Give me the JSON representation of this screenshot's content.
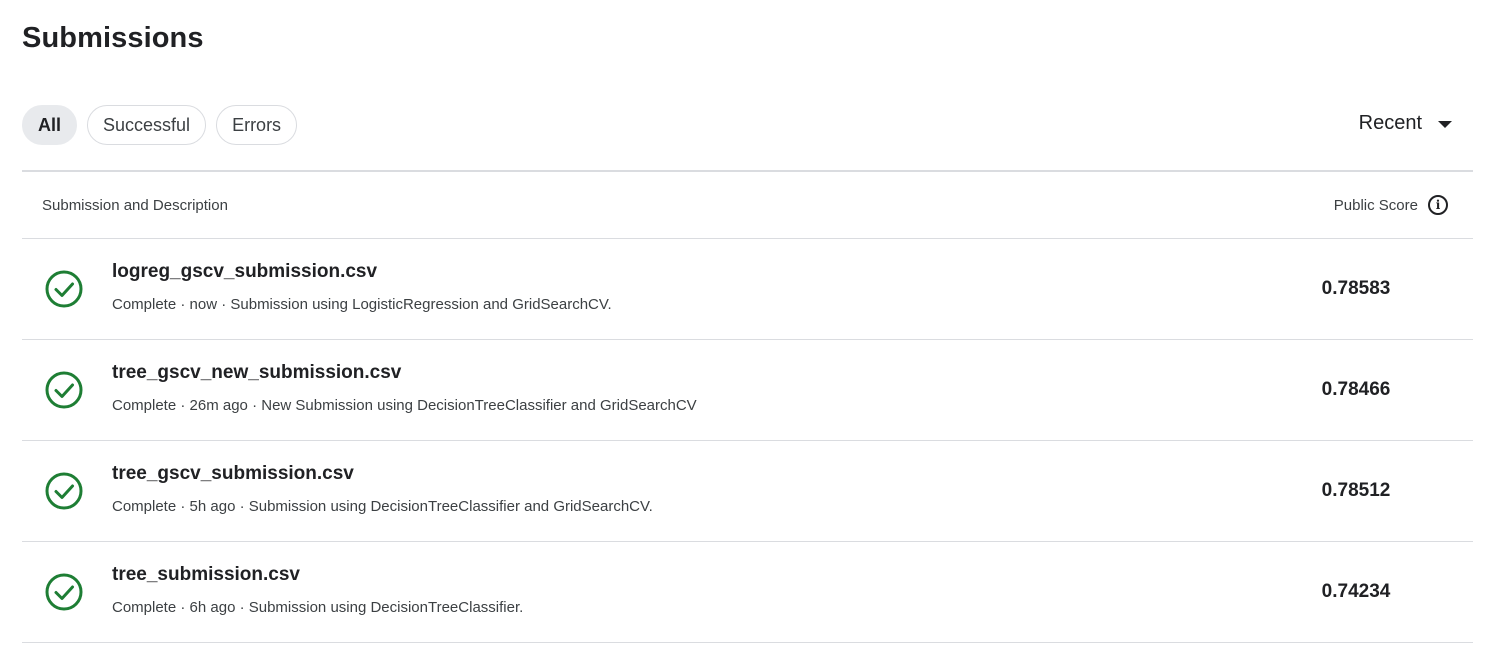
{
  "page": {
    "title": "Submissions"
  },
  "filters": [
    {
      "label": "All",
      "active": true
    },
    {
      "label": "Successful",
      "active": false
    },
    {
      "label": "Errors",
      "active": false
    }
  ],
  "sort": {
    "label": "Recent"
  },
  "table": {
    "col_left": "Submission and Description",
    "col_right": "Public Score",
    "rows": [
      {
        "file": "logreg_gscv_submission.csv",
        "meta": "Complete · now · Submission using LogisticRegression and GridSearchCV.",
        "score": "0.78583"
      },
      {
        "file": "tree_gscv_new_submission.csv",
        "meta": "Complete · 26m ago · New Submission using DecisionTreeClassifier and GridSearchCV",
        "score": "0.78466"
      },
      {
        "file": "tree_gscv_submission.csv",
        "meta": "Complete · 5h ago · Submission using DecisionTreeClassifier and GridSearchCV.",
        "score": "0.78512"
      },
      {
        "file": "tree_submission.csv",
        "meta": "Complete · 6h ago · Submission using DecisionTreeClassifier.",
        "score": "0.74234"
      }
    ]
  },
  "colors": {
    "success": "#1e7e34",
    "divider": "#dadce0",
    "chip_active": "#e8eaed"
  },
  "icons": {
    "status": "check-circle-icon",
    "info": "info-icon",
    "sort": "caret-down-icon"
  }
}
